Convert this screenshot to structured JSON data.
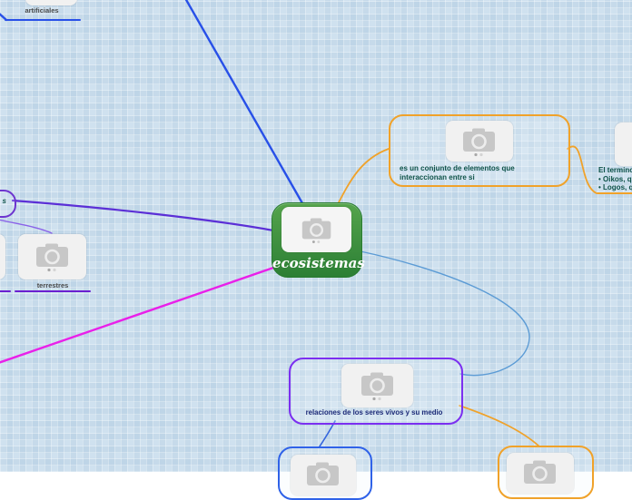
{
  "palette": {
    "background": "#cfe1ef",
    "green_top": "#55a44c",
    "green_bottom": "#2c7f35",
    "orange": "#f0a22a",
    "violet_border": "#7b2ff0",
    "pill_border": "#6d35cf",
    "blue_line": "#2850e8",
    "violet_line": "#5b2fd6",
    "light_violet_line": "#8a62e8",
    "magenta_line": "#e920e9",
    "light_blue_line": "#5b9bd5",
    "purple_underline": "#6a1fd0",
    "teal_text": "#0e5248",
    "navy_text": "#1c2a78",
    "gray_text": "#4a4a4a",
    "placeholder_bg": "#f1f1f1",
    "camera_gray": "#c7c7c7"
  },
  "nodes": {
    "center": {
      "label": "ecosistemas"
    },
    "definition": {
      "text": "es un conjunto de elementos que interaccionan entre si"
    },
    "etymology": {
      "lines": [
        "El termino E",
        "• Oikos, que",
        "• Logos, que"
      ]
    },
    "relations": {
      "text": "relaciones de los seres vivos y su medio"
    },
    "artificiales": {
      "label": "artificiales"
    },
    "terrestres": {
      "label": "terrestres"
    },
    "left_pill": {
      "label": "s"
    }
  }
}
